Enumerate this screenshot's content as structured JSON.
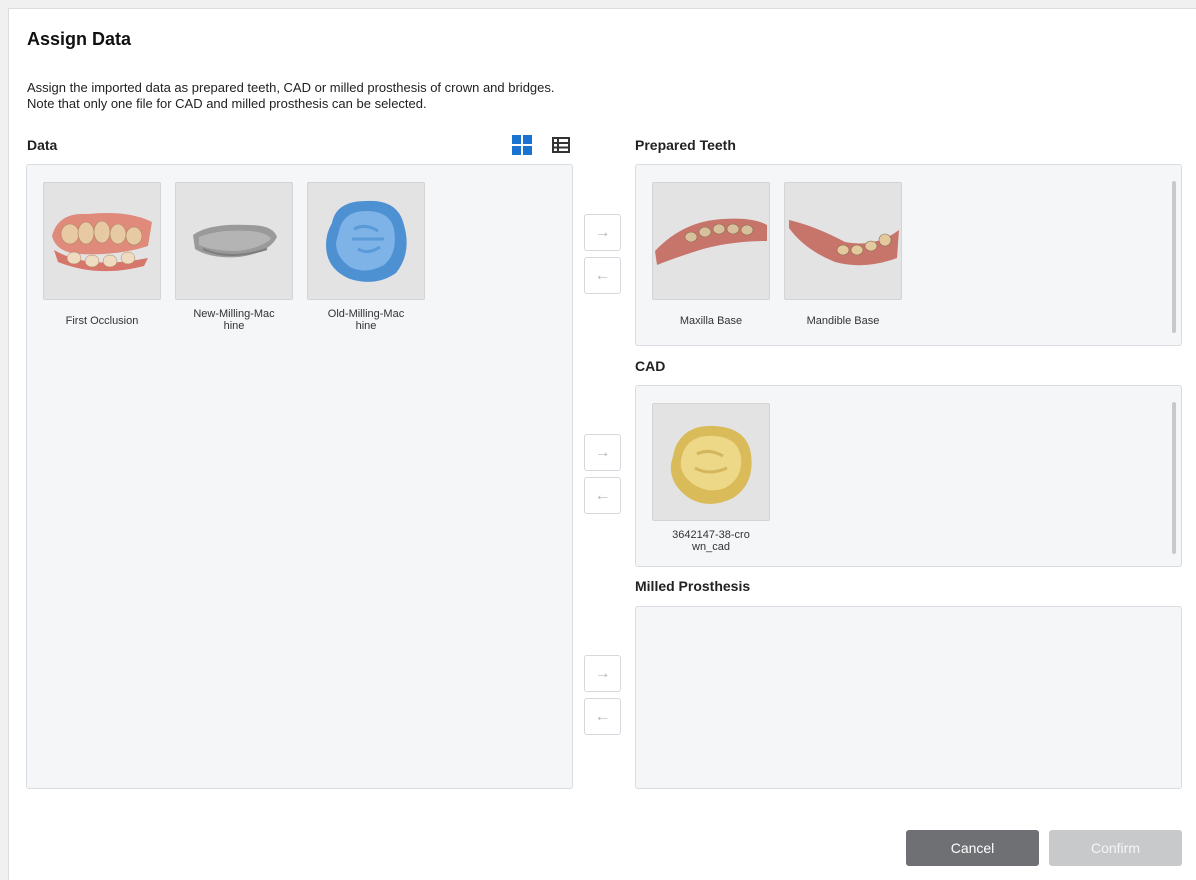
{
  "dialog": {
    "title": "Assign Data",
    "description_line1": "Assign the imported data as prepared teeth, CAD or milled prosthesis of crown and bridges.",
    "description_line2": "Note that only one file for CAD and milled prosthesis can be selected."
  },
  "data_panel": {
    "label": "Data",
    "view_icons": [
      "grid-view-icon",
      "list-view-icon"
    ],
    "items": [
      {
        "name": "First Occlusion",
        "thumb": "occlusion-model"
      },
      {
        "name": "New-Milling-Mac hine",
        "line1": "New-Milling-Mac",
        "line2": "hine",
        "thumb": "gray-model"
      },
      {
        "name": "Old-Milling-Mac hine",
        "line1": "Old-Milling-Mac",
        "line2": "hine",
        "thumb": "blue-crown"
      }
    ]
  },
  "prepared_teeth": {
    "label": "Prepared Teeth",
    "items": [
      {
        "name": "Maxilla Base"
      },
      {
        "name": "Mandible Base"
      }
    ]
  },
  "cad": {
    "label": "CAD",
    "items": [
      {
        "line1": "3642147-38-cro",
        "line2": "wn_cad"
      }
    ]
  },
  "milled": {
    "label": "Milled Prosthesis",
    "items": []
  },
  "arrows": {
    "right": "→",
    "left": "←"
  },
  "buttons": {
    "cancel": "Cancel",
    "confirm": "Confirm"
  },
  "colors": {
    "accent": "#1a73d0",
    "cancel_bg": "#6e7073",
    "confirm_bg_disabled": "#c8c9cb"
  }
}
